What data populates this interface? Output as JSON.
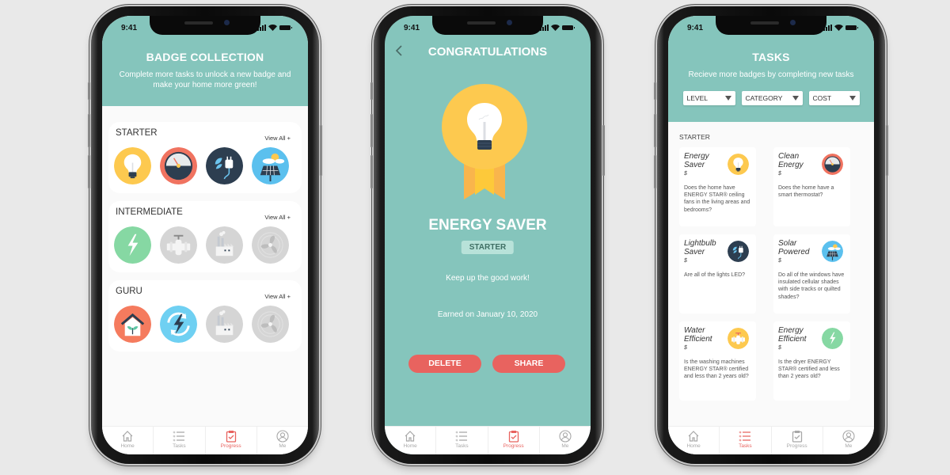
{
  "status_time": "9:41",
  "colors": {
    "teal": "#85c5bc",
    "accent_red": "#e8635f",
    "background": "#e9e9e9"
  },
  "tabbar": {
    "items": [
      {
        "label": "Home",
        "icon": "home-icon"
      },
      {
        "label": "Tasks",
        "icon": "list-icon"
      },
      {
        "label": "Progress",
        "icon": "clipboard-check-icon"
      },
      {
        "label": "Me",
        "icon": "user-icon"
      }
    ]
  },
  "screen1": {
    "title": "BADGE COLLECTION",
    "subtitle": "Complete more tasks to unlock a new badge and make your home more green!",
    "view_all": "View All +",
    "sections": [
      {
        "title": "STARTER",
        "badges": [
          {
            "name": "lightbulb-badge",
            "unlocked": true
          },
          {
            "name": "gauge-badge",
            "unlocked": true
          },
          {
            "name": "eco-plug-badge",
            "unlocked": true
          },
          {
            "name": "solar-panel-badge",
            "unlocked": true
          }
        ]
      },
      {
        "title": "INTERMEDIATE",
        "badges": [
          {
            "name": "lightning-badge",
            "unlocked": true
          },
          {
            "name": "water-pipe-badge",
            "unlocked": false
          },
          {
            "name": "factory-badge",
            "unlocked": false
          },
          {
            "name": "fan-badge",
            "unlocked": false
          }
        ]
      },
      {
        "title": "GURU",
        "badges": [
          {
            "name": "green-home-badge",
            "unlocked": true
          },
          {
            "name": "renewable-energy-badge",
            "unlocked": true
          },
          {
            "name": "factory-badge",
            "unlocked": false
          },
          {
            "name": "fan-badge",
            "unlocked": false
          }
        ]
      }
    ],
    "active_tab": "Progress"
  },
  "screen2": {
    "title": "CONGRATULATIONS",
    "badge_name": "ENERGY SAVER",
    "level": "STARTER",
    "message": "Keep up the good work!",
    "earned": "Earned on January 10, 2020",
    "delete_label": "DELETE",
    "share_label": "SHARE",
    "active_tab": "Progress"
  },
  "screen3": {
    "title": "TASKS",
    "subtitle": "Recieve more badges by completing new tasks",
    "filters": [
      {
        "label": "LEVEL"
      },
      {
        "label": "CATEGORY"
      },
      {
        "label": "COST"
      }
    ],
    "section": "STARTER",
    "tasks": [
      {
        "title": "Energy Saver",
        "cost": "$",
        "desc": "Does the home have ENERGY STAR® ceiling fans in the living areas and bedrooms?",
        "icon": "lightbulb-icon"
      },
      {
        "title": "Clean Energy",
        "cost": "$",
        "desc": "Does the home have a smart thermostat?",
        "icon": "gauge-icon"
      },
      {
        "title": "Lightbulb Saver",
        "cost": "$",
        "desc": "Are all of the lights LED?",
        "icon": "eco-plug-icon"
      },
      {
        "title": "Solar Powered",
        "cost": "$",
        "desc": "Do all of the windows have insulated cellular shades with side tracks or quilted shades?",
        "icon": "solar-panel-icon"
      },
      {
        "title": "Water Efficient",
        "cost": "$",
        "desc": "Is the washing machines ENERGY STAR® certified and less than 2 years old?",
        "icon": "water-pipe-icon"
      },
      {
        "title": "Energy Efficient",
        "cost": "$",
        "desc": "Is the dryer ENERGY STAR® certified and less than 2 years old?",
        "icon": "lightning-icon"
      }
    ],
    "active_tab": "Tasks"
  }
}
